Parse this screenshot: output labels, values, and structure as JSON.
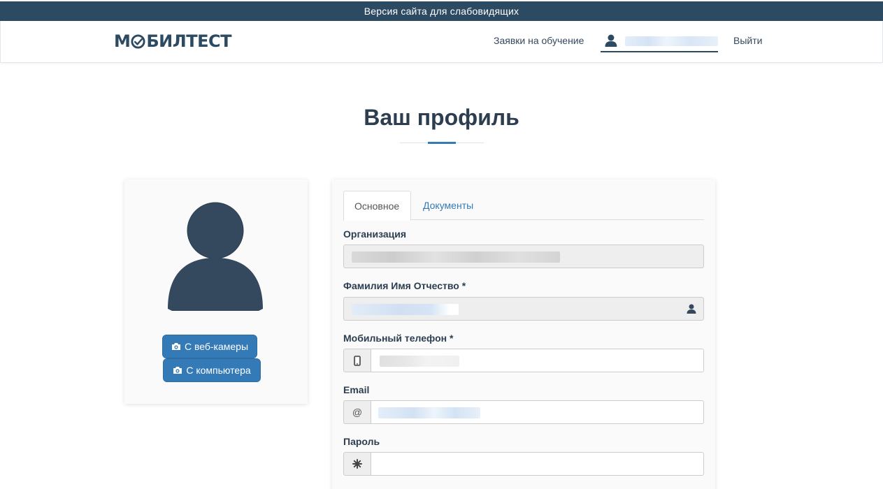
{
  "accessibility_banner": "Версия сайта для слабовидящих",
  "brand": {
    "logo_left": "М",
    "logo_right": "БИЛТЕСТ"
  },
  "nav": {
    "requests": "Заявки на обучение",
    "logout": "Выйти"
  },
  "page": {
    "title": "Ваш профиль"
  },
  "photo": {
    "webcam_button": "С веб-камеры",
    "computer_button": "С компьютера"
  },
  "tabs": [
    {
      "label": "Основное",
      "active": true
    },
    {
      "label": "Документы",
      "active": false
    }
  ],
  "form": {
    "organization_label": "Организация",
    "fullname_label": "Фамилия Имя Отчество *",
    "phone_label": "Мобильный телефон *",
    "email_label": "Email",
    "email_addon": "@",
    "password_label": "Пароль"
  },
  "colors": {
    "banner": "#2d4a63",
    "primary": "#337ab7",
    "text": "#2c3e50"
  },
  "icons": {
    "user": "user-icon",
    "camera": "camera-icon",
    "phone": "mobile-phone-icon",
    "password": "asterisk-icon"
  }
}
